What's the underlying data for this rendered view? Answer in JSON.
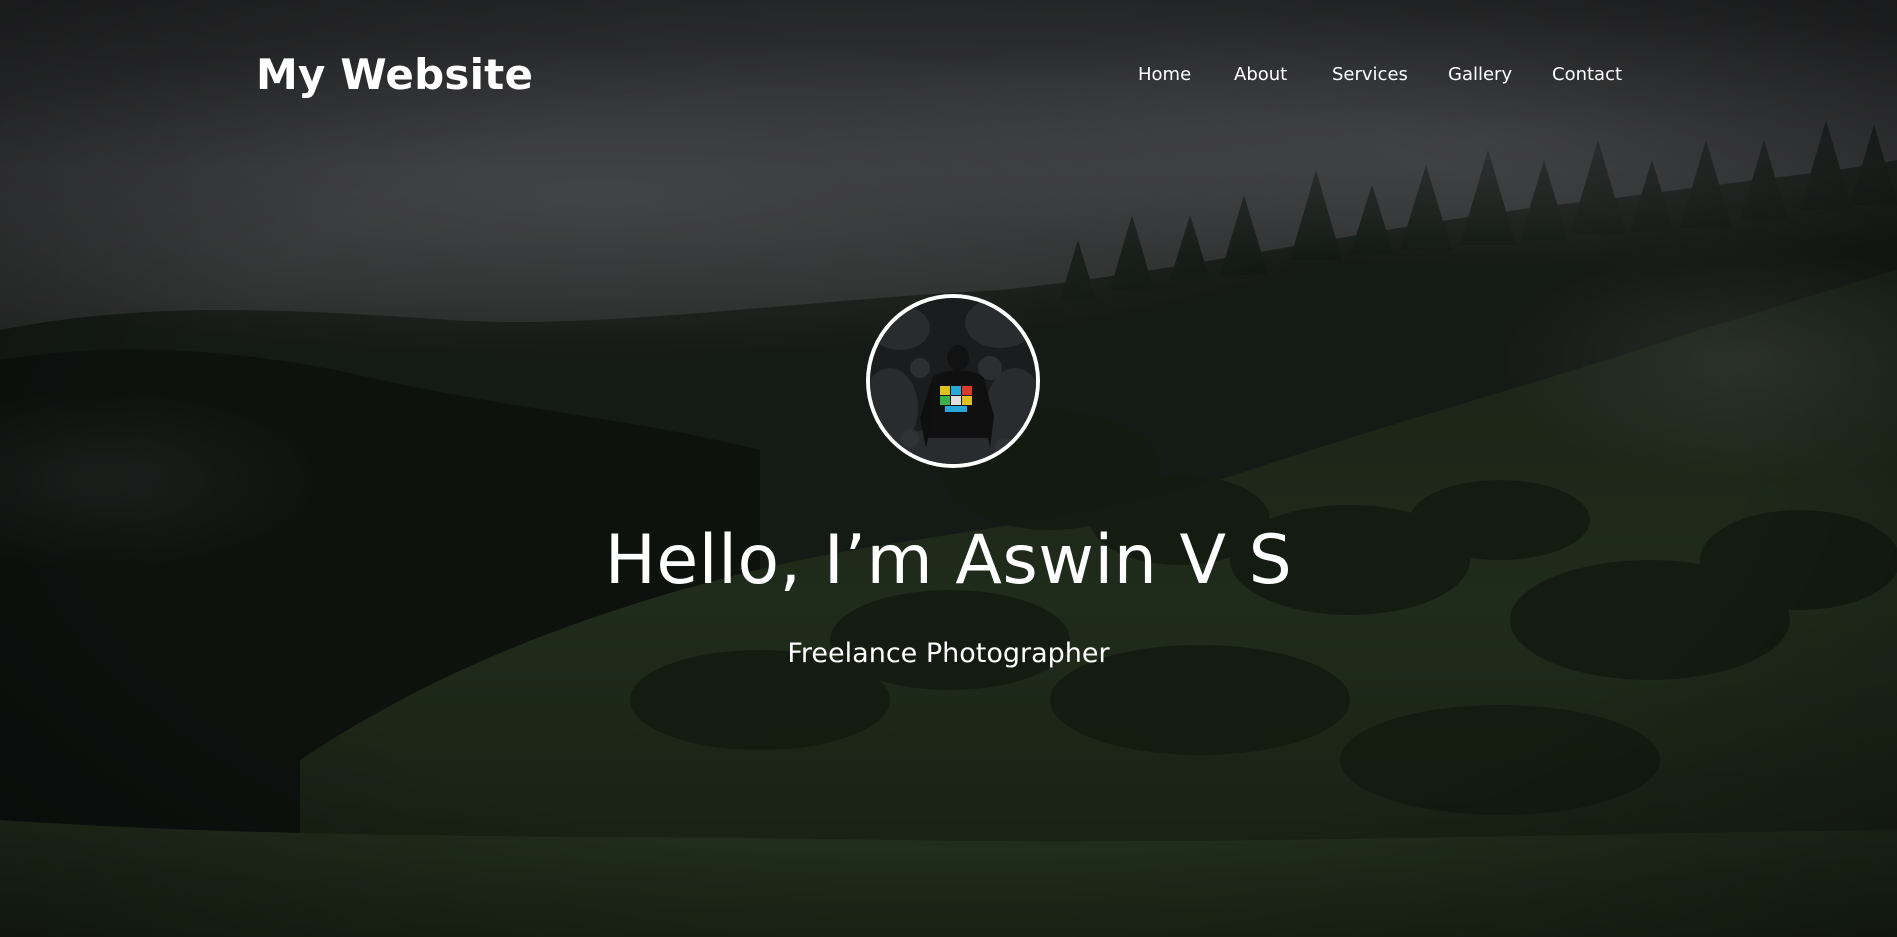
{
  "site": {
    "brand": "My Website"
  },
  "nav": {
    "items": [
      {
        "label": "Home"
      },
      {
        "label": "About"
      },
      {
        "label": "Services"
      },
      {
        "label": "Gallery"
      },
      {
        "label": "Contact"
      }
    ]
  },
  "hero": {
    "headline": "Hello, I’m Aswin V S",
    "subtitle": "Freelance Photographer",
    "background": "misty-forest-hillside-photo",
    "avatar": "profile-photo"
  },
  "colors": {
    "text": "#ffffff",
    "overlay": "#000000",
    "sky": "#4a4b4d",
    "forest": "#1c2a1e",
    "grass": "#2e4228",
    "avatar_border": "#ffffff"
  }
}
